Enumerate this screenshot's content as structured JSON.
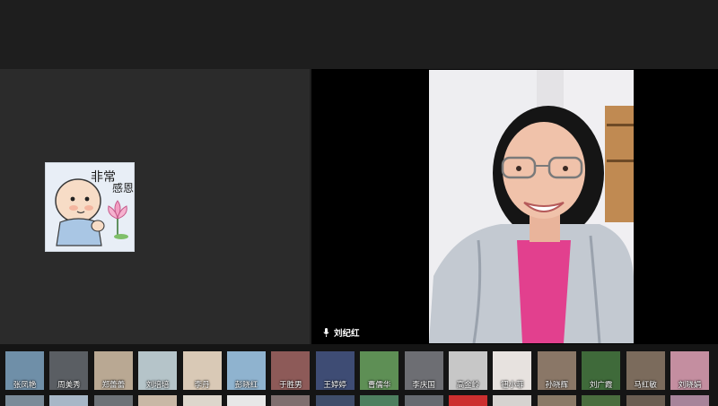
{
  "speaker": {
    "name": "刘纪红"
  },
  "sticker": {
    "line1": "非常",
    "line2": "感恩"
  },
  "participants": [
    {
      "name": "张凤艳",
      "color": "#6f8fa8"
    },
    {
      "name": "周美秀",
      "color": "#5a5e63"
    },
    {
      "name": "郑蕾蕾",
      "color": "#b9a893"
    },
    {
      "name": "刘培培",
      "color": "#b5c4c9"
    },
    {
      "name": "李丹",
      "color": "#d9c9b6"
    },
    {
      "name": "彭晓红",
      "color": "#8fb3cf"
    },
    {
      "name": "于胜男",
      "color": "#8d5a58"
    },
    {
      "name": "王婷婷",
      "color": "#3e4c74"
    },
    {
      "name": "曹儒华",
      "color": "#5e8f55"
    },
    {
      "name": "李庆国",
      "color": "#6d6e73"
    },
    {
      "name": "高金岭",
      "color": "#c7c7c7"
    },
    {
      "name": "钮小菲",
      "color": "#e7e2df"
    },
    {
      "name": "孙晓辉",
      "color": "#8a7767"
    },
    {
      "name": "刘广霞",
      "color": "#3f6a3a"
    },
    {
      "name": "马红敏",
      "color": "#7b6b5c"
    },
    {
      "name": "刘晓娟",
      "color": "#c48ea0"
    }
  ],
  "second_row_colors": [
    "#7a8b99",
    "#a7b7c7",
    "#6d7277",
    "#c9b8a6",
    "#ddd6cc",
    "#e7e7e7",
    "#7f6f6f",
    "#3f4d6a",
    "#4d7f5f",
    "#666a70",
    "#cc2f2f",
    "#d6d3d0",
    "#8a7a67",
    "#4a6d3e",
    "#6b5e52",
    "#a7849a"
  ]
}
